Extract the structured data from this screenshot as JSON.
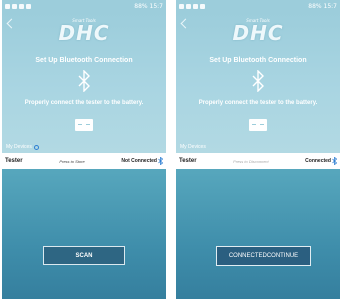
{
  "screens": [
    {
      "status_time": "15:7",
      "status_battery": "88%",
      "logo_small": "Smart Tools",
      "logo": "DHC",
      "setup_title": "Set Up  Bluetooth Connection",
      "instruction": "Properly connect the tester to the battery.",
      "my_devices": "My Devices",
      "tester_name": "Tester",
      "press_hint": "Press to Store",
      "connection_status": "Not Connected",
      "action_button": "SCAN"
    },
    {
      "status_time": "15:7",
      "status_battery": "88%",
      "logo_small": "Smart Tools",
      "logo": "DHC",
      "setup_title": "Set Up  Bluetooth Connection",
      "instruction": "Properly connect the tester to the battery.",
      "my_devices": "My Devices",
      "tester_name": "Tester",
      "press_hint": "Press to Disconnect",
      "connection_status": "Connected",
      "action_button": "CONNECTEDCONTINUE"
    }
  ],
  "colors": {
    "top_bg": "#9ccddb",
    "bottom_bg": "#3f8eab",
    "button_bg": "#2e6683",
    "bluetooth_blue": "#2f7fd3"
  },
  "icons": [
    "back-arrow-icon",
    "bluetooth-icon",
    "battery-icon",
    "refresh-icon"
  ]
}
